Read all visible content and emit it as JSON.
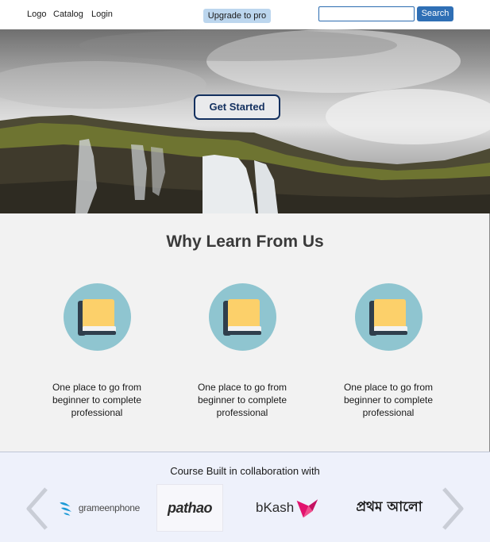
{
  "nav": {
    "links": [
      "Logo",
      "Catalog",
      "Login"
    ],
    "upgrade_label": "Upgrade to pro",
    "search_placeholder": "",
    "search_label": "Search"
  },
  "hero": {
    "cta_label": "Get Started",
    "image": "waterfall-landscape"
  },
  "features": {
    "title": "Why Learn From Us",
    "items": [
      {
        "icon": "book-icon",
        "text": "One place to go from beginner to complete professional"
      },
      {
        "icon": "book-icon",
        "text": "One place to go from beginner to complete professional"
      },
      {
        "icon": "book-icon",
        "text": "One place to go from beginner to complete professional"
      }
    ]
  },
  "partners": {
    "title": "Course Built in collaboration with",
    "logos": [
      {
        "name": "grameenphone",
        "text": "grameenphone"
      },
      {
        "name": "pathao",
        "text": "pathao"
      },
      {
        "name": "bkash",
        "text": "bKash"
      },
      {
        "name": "prothom-alo",
        "text": "প্রথম আলো"
      }
    ],
    "prev_icon": "chevron-left-icon",
    "next_icon": "chevron-right-icon"
  },
  "colors": {
    "upgrade_bg": "#bcd6ee",
    "search_button": "#2f6fb5",
    "cta_border": "#13305f",
    "feature_circle": "#8fc5d0",
    "book_yellow": "#fcd06a",
    "book_spine": "#2f3e4c",
    "partners_bg": "#eef1fb",
    "bkash_pink": "#e2136e",
    "gp_blue": "#1c9ad6"
  }
}
